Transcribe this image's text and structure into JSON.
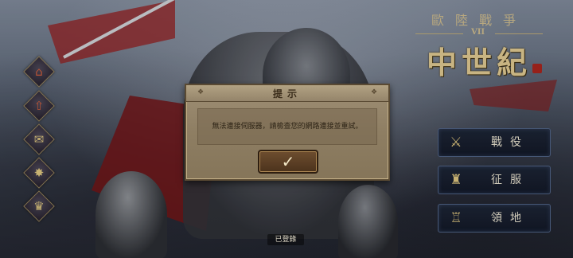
{
  "logo": {
    "subtitle": "歐陸戰爭",
    "edition": "VII",
    "title": "中世紀"
  },
  "side_menu": [
    {
      "name": "castle",
      "icon": "⌂"
    },
    {
      "name": "upload",
      "icon": "⇧"
    },
    {
      "name": "mail",
      "icon": "✉"
    },
    {
      "name": "settings",
      "icon": "✸"
    },
    {
      "name": "crown",
      "icon": "♛"
    }
  ],
  "main_menu": {
    "campaign": {
      "label": "戰役",
      "icon": "⚔"
    },
    "conquest": {
      "label": "征服",
      "icon": "♜"
    },
    "territory": {
      "label": "領地",
      "icon": "♖"
    }
  },
  "dialog": {
    "title": "提示",
    "message": "無法連接伺服器，請檢查您的網路連接並重試。",
    "confirm_icon": "✓"
  },
  "status": {
    "login": "已登錄"
  },
  "colors": {
    "dialog_bg": "#8e7e63",
    "button_bg": "#121826",
    "gold": "#d9c48e"
  }
}
